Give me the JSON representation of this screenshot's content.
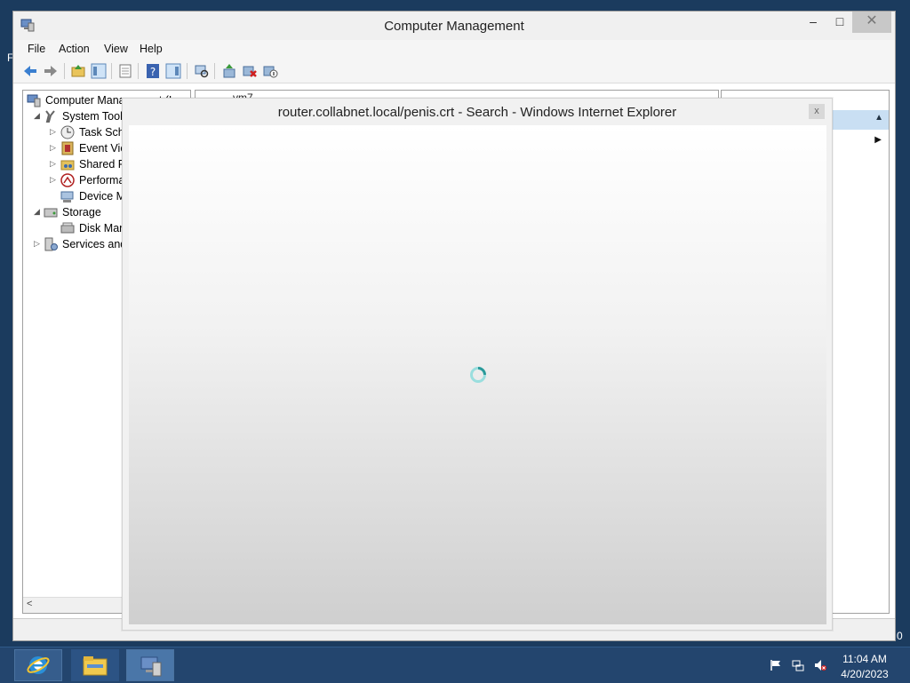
{
  "window": {
    "title": "Computer Management",
    "minimize_glyph": "–",
    "maximize_glyph": "□",
    "close_glyph": "✕"
  },
  "menu": [
    "File",
    "Action",
    "View",
    "Help"
  ],
  "tree": {
    "items": [
      {
        "label": "Computer Management (Local",
        "icon": "computer-management-icon"
      },
      {
        "label": "System Tools",
        "icon": "system-tools-icon"
      },
      {
        "label": "Task Sche",
        "icon": "clock-icon"
      },
      {
        "label": "Event Vie",
        "icon": "event-viewer-icon"
      },
      {
        "label": "Shared Fo",
        "icon": "shared-folders-icon"
      },
      {
        "label": "Performa",
        "icon": "performance-icon"
      },
      {
        "label": "Device M",
        "icon": "device-manager-icon"
      },
      {
        "label": "Storage",
        "icon": "storage-icon"
      },
      {
        "label": "Disk Man",
        "icon": "disk-management-icon"
      },
      {
        "label": "Services and",
        "icon": "services-icon"
      }
    ]
  },
  "center": {
    "breadcrumb_partial": "vm7"
  },
  "ie_dialog": {
    "title": "router.collabnet.local/penis.crt - Search - Windows Internet Explorer",
    "close_glyph": "x"
  },
  "taskbar": {
    "apps": [
      "internet-explorer-icon",
      "file-explorer-icon",
      "computer-management-icon"
    ],
    "time": "11:04 AM",
    "date": "4/20/2023"
  },
  "colors": {
    "taskbar": "#23456e",
    "selection": "#c9dff3",
    "spinner": "#3cb4b4"
  }
}
